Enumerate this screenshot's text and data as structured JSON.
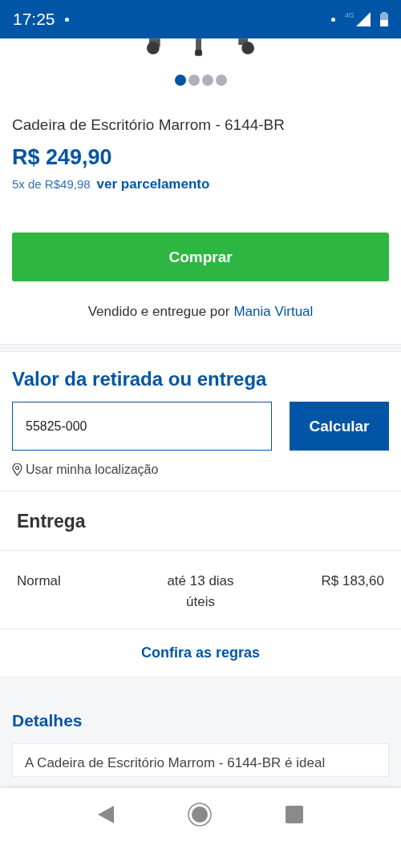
{
  "status_bar": {
    "time": "17:25",
    "network": "4G"
  },
  "gallery": {
    "dots": [
      {
        "selected": true
      },
      {
        "selected": false
      },
      {
        "selected": false
      },
      {
        "selected": false
      }
    ]
  },
  "product": {
    "title": "Cadeira de Escritório Marrom - 6144-BR",
    "price": "R$ 249,90",
    "installments": "5x de R$49,98",
    "installments_link": "ver parcelamento",
    "buy_button": "Comprar",
    "sold_by": "Vendido e entregue por",
    "seller": "Mania Virtual"
  },
  "shipping": {
    "title": "Valor da retirada ou entrega",
    "cep_value": "55825-000",
    "calc_button": "Calcular",
    "use_location": "Usar minha localização"
  },
  "delivery": {
    "title": "Entrega",
    "options": [
      {
        "type": "Normal",
        "time": "até 13 dias úteis",
        "price": "R$ 183,60"
      }
    ],
    "rules_link": "Confira as regras"
  },
  "details": {
    "title": "Detalhes",
    "text": "A Cadeira de Escritório Marrom - 6144-BR é ideal"
  }
}
